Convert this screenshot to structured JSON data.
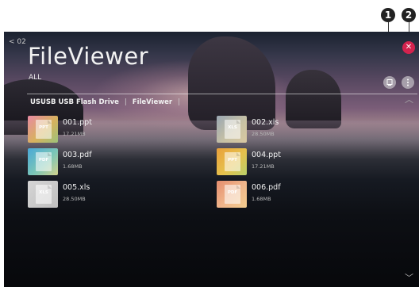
{
  "callouts": [
    "1",
    "2"
  ],
  "header": {
    "back_label": "< 02",
    "title": "FileViewer",
    "filter": "ALL"
  },
  "breadcrumb": {
    "device": "USUSB USB Flash Drive",
    "folder": "FileViewer",
    "separator": "|"
  },
  "files": [
    {
      "type": "PPT",
      "name": "001.ppt",
      "size": "17.21MB"
    },
    {
      "type": "XLS",
      "name": "002.xls",
      "size": "28.50MB"
    },
    {
      "type": "PDF",
      "name": "003.pdf",
      "size": "1.68MB"
    },
    {
      "type": "PPT",
      "name": "004.ppt",
      "size": "17.21MB"
    },
    {
      "type": "XLS",
      "name": "005.xls",
      "size": "28.50MB"
    },
    {
      "type": "PDF",
      "name": "006.pdf",
      "size": "1.68MB"
    }
  ],
  "colors": {
    "close_button": "#d4234e",
    "text_primary": "#f2f2f2",
    "text_secondary": "#b8b8b8"
  },
  "icons": {
    "close": "close-icon",
    "view_mode": "view-mode-icon",
    "options": "more-options-icon",
    "scroll_up": "chevron-up-icon",
    "scroll_down": "chevron-down-icon"
  }
}
